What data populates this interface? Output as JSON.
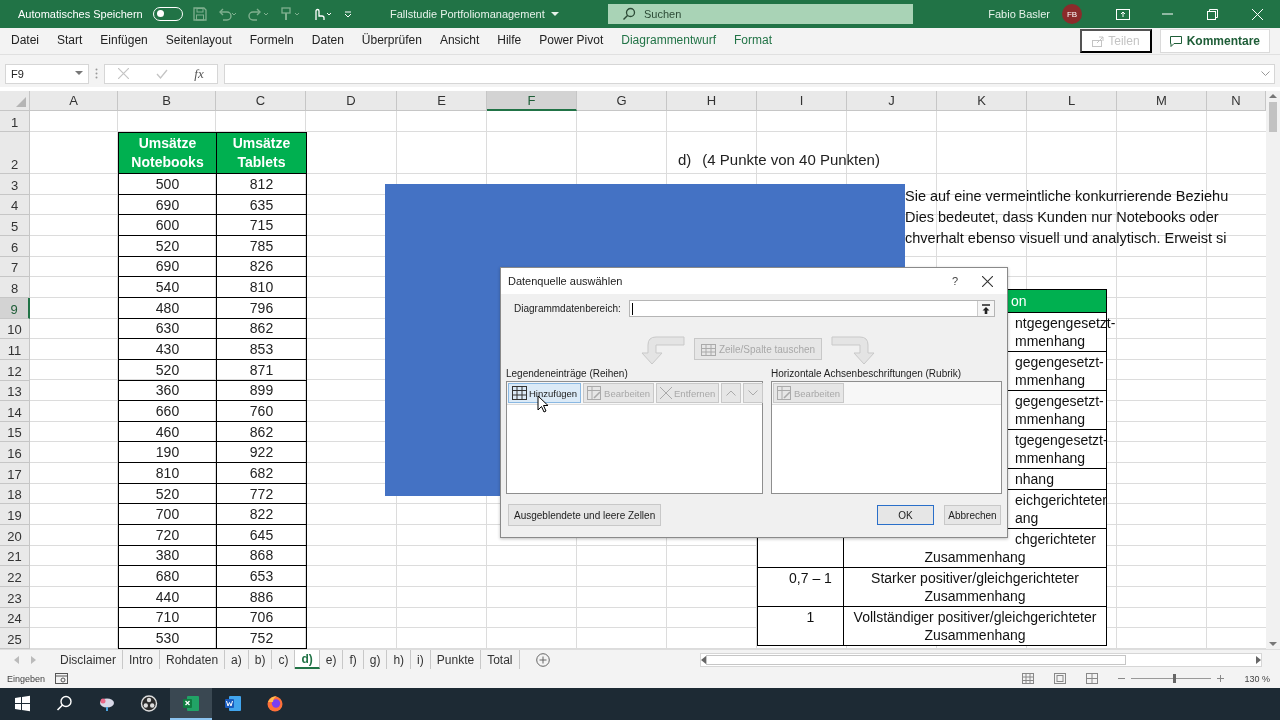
{
  "window": {
    "autosave_label": "Automatisches Speichern",
    "autosave_on": false,
    "title": "Fallstudie Portfoliomanagement",
    "search_placeholder": "Suchen",
    "user_name": "Fabio Basler",
    "user_initials": "FB"
  },
  "ribbon": {
    "tabs": [
      {
        "label": "Datei",
        "selected": false,
        "kind": "normal"
      },
      {
        "label": "Start",
        "selected": false,
        "kind": "normal"
      },
      {
        "label": "Einfügen",
        "selected": false,
        "kind": "normal"
      },
      {
        "label": "Seitenlayout",
        "selected": false,
        "kind": "normal"
      },
      {
        "label": "Formeln",
        "selected": false,
        "kind": "normal"
      },
      {
        "label": "Daten",
        "selected": false,
        "kind": "normal"
      },
      {
        "label": "Überprüfen",
        "selected": false,
        "kind": "normal"
      },
      {
        "label": "Ansicht",
        "selected": false,
        "kind": "normal"
      },
      {
        "label": "Hilfe",
        "selected": false,
        "kind": "normal"
      },
      {
        "label": "Power Pivot",
        "selected": false,
        "kind": "normal"
      },
      {
        "label": "Diagrammentwurf",
        "selected": false,
        "kind": "contextual"
      },
      {
        "label": "Format",
        "selected": false,
        "kind": "contextual"
      }
    ],
    "share": {
      "label": "Teilen",
      "disabled": true
    },
    "comments": {
      "label": "Kommentare"
    }
  },
  "formula_bar": {
    "name_box": "F9",
    "function_label": "fx"
  },
  "sheet": {
    "columns": [
      {
        "label": "A",
        "selected": false
      },
      {
        "label": "B",
        "selected": false
      },
      {
        "label": "C",
        "selected": false
      },
      {
        "label": "D",
        "selected": false
      },
      {
        "label": "E",
        "selected": false
      },
      {
        "label": "F",
        "selected": true
      },
      {
        "label": "G",
        "selected": false
      },
      {
        "label": "H",
        "selected": false
      },
      {
        "label": "I",
        "selected": false
      },
      {
        "label": "J",
        "selected": false
      },
      {
        "label": "K",
        "selected": false
      },
      {
        "label": "L",
        "selected": false
      },
      {
        "label": "M",
        "selected": false
      },
      {
        "label": "N",
        "selected": false
      }
    ],
    "rows": [
      {
        "label": "1",
        "selected": false
      },
      {
        "label": "2",
        "selected": false
      },
      {
        "label": "3",
        "selected": false
      },
      {
        "label": "4",
        "selected": false
      },
      {
        "label": "5",
        "selected": false
      },
      {
        "label": "6",
        "selected": false
      },
      {
        "label": "7",
        "selected": false
      },
      {
        "label": "8",
        "selected": false
      },
      {
        "label": "9",
        "selected": true
      },
      {
        "label": "10",
        "selected": false
      },
      {
        "label": "11",
        "selected": false
      },
      {
        "label": "12",
        "selected": false
      },
      {
        "label": "13",
        "selected": false
      },
      {
        "label": "14",
        "selected": false
      },
      {
        "label": "15",
        "selected": false
      },
      {
        "label": "16",
        "selected": false
      },
      {
        "label": "17",
        "selected": false
      },
      {
        "label": "18",
        "selected": false
      },
      {
        "label": "19",
        "selected": false
      },
      {
        "label": "20",
        "selected": false
      },
      {
        "label": "21",
        "selected": false
      },
      {
        "label": "22",
        "selected": false
      },
      {
        "label": "23",
        "selected": false
      },
      {
        "label": "24",
        "selected": false
      },
      {
        "label": "25",
        "selected": false
      }
    ],
    "sales_table": {
      "columns": [
        "Umsätze Notebooks",
        "Umsätze Tablets"
      ],
      "rows": [
        [
          "500",
          "812"
        ],
        [
          "690",
          "635"
        ],
        [
          "600",
          "715"
        ],
        [
          "520",
          "785"
        ],
        [
          "690",
          "826"
        ],
        [
          "540",
          "810"
        ],
        [
          "480",
          "796"
        ],
        [
          "630",
          "862"
        ],
        [
          "430",
          "853"
        ],
        [
          "520",
          "871"
        ],
        [
          "360",
          "899"
        ],
        [
          "660",
          "760"
        ],
        [
          "460",
          "862"
        ],
        [
          "190",
          "922"
        ],
        [
          "810",
          "682"
        ],
        [
          "520",
          "772"
        ],
        [
          "700",
          "822"
        ],
        [
          "720",
          "645"
        ],
        [
          "380",
          "868"
        ],
        [
          "680",
          "653"
        ],
        [
          "440",
          "886"
        ],
        [
          "710",
          "706"
        ],
        [
          "530",
          "752"
        ]
      ]
    },
    "task_label": "d)",
    "task_points": "(4 Punkte von 40 Punkten)",
    "paragraph_lines": [
      "Sie auf eine vermeintliche konkurrierende Beziehu",
      "Dies bedeutet, dass Kunden nur Notebooks oder",
      "chverhalt ebenso visuell und analytisch. Erweist si"
    ]
  },
  "correlation_table": {
    "header": "on",
    "rows": [
      {
        "lines": [
          {
            "text": "ntgegengesetzt-",
            "kind": "partial"
          },
          {
            "text": "mmenhang",
            "kind": "partial"
          }
        ]
      },
      {
        "lines": [
          {
            "text": "gegengesetzt-",
            "kind": "partial"
          },
          {
            "text": "mmenhang",
            "kind": "partial"
          }
        ]
      },
      {
        "lines": [
          {
            "text": "gegengesetzt-",
            "kind": "partial"
          },
          {
            "text": "mmenhang",
            "kind": "partial"
          }
        ]
      },
      {
        "lines": [
          {
            "text": "tgegengesetzt-",
            "kind": "partial"
          },
          {
            "text": "mmenhang",
            "kind": "partial"
          }
        ]
      },
      {
        "lines": [
          {
            "text": "nhang",
            "kind": "partial"
          }
        ]
      },
      {
        "lines": [
          {
            "text": "eichgerichteter",
            "kind": "partial"
          },
          {
            "text": "ang",
            "kind": "partial"
          }
        ]
      },
      {
        "lines": [
          {
            "text": "chgerichteter",
            "kind": "partial"
          },
          {
            "text": "Zusammenhang",
            "kind": "full"
          }
        ]
      },
      {
        "range": "0,7 – 1",
        "lines": [
          {
            "text": "Starker positiver/gleichgerichteter",
            "kind": "full"
          },
          {
            "text": "Zusammenhang",
            "kind": "full"
          }
        ]
      },
      {
        "range": "1",
        "lines": [
          {
            "text": "Vollständiger positiver/gleichgerichteter",
            "kind": "full"
          },
          {
            "text": "Zusammenhang",
            "kind": "full"
          }
        ]
      }
    ]
  },
  "dialog": {
    "title": "Datenquelle auswählen",
    "help": "?",
    "range_label": "Diagrammdatenbereich:",
    "switch_button": {
      "label": "Zeile/Spalte tauschen",
      "disabled": true
    },
    "series_panel": {
      "label": "Legendeneinträge (Reihen)",
      "buttons": [
        {
          "kind": "add",
          "label": "Hinzufügen",
          "disabled": false,
          "hover": true
        },
        {
          "kind": "edit",
          "label": "Bearbeiten",
          "disabled": true,
          "hover": false
        },
        {
          "kind": "remove",
          "label": "Entfernen",
          "disabled": true,
          "hover": false
        },
        {
          "kind": "up",
          "disabled": true,
          "hover": false
        },
        {
          "kind": "down",
          "disabled": true,
          "hover": false
        }
      ]
    },
    "category_panel": {
      "label": "Horizontale Achsenbeschriftungen (Rubrik)",
      "buttons": [
        {
          "kind": "edit",
          "label": "Bearbeiten",
          "disabled": true,
          "hover": false
        }
      ]
    },
    "hidden_cells_button": "Ausgeblendete und leere Zellen",
    "ok": {
      "label": "OK",
      "default": true
    },
    "cancel": "Abbrechen"
  },
  "sheet_tabs": [
    {
      "label": "Disclaimer",
      "selected": false
    },
    {
      "label": "Intro",
      "selected": false
    },
    {
      "label": "Rohdaten",
      "selected": false
    },
    {
      "label": "a)",
      "selected": false
    },
    {
      "label": "b)",
      "selected": false
    },
    {
      "label": "c)",
      "selected": false
    },
    {
      "label": "d)",
      "selected": true
    },
    {
      "label": "e)",
      "selected": false
    },
    {
      "label": "f)",
      "selected": false
    },
    {
      "label": "g)",
      "selected": false
    },
    {
      "label": "h)",
      "selected": false
    },
    {
      "label": "i)",
      "selected": false
    },
    {
      "label": "Punkte",
      "selected": false
    },
    {
      "label": "Total",
      "selected": false
    }
  ],
  "status_bar": {
    "mode": "Eingeben",
    "zoom": {
      "level": 0.53,
      "reading": "130 %"
    }
  },
  "taskbar": [
    {
      "kind": "start",
      "active": false
    },
    {
      "kind": "search",
      "active": false
    },
    {
      "kind": "snip",
      "active": false
    },
    {
      "kind": "recorder",
      "active": false
    },
    {
      "kind": "excel",
      "active": true
    },
    {
      "kind": "word",
      "active": false
    },
    {
      "kind": "browser",
      "active": false
    }
  ]
}
